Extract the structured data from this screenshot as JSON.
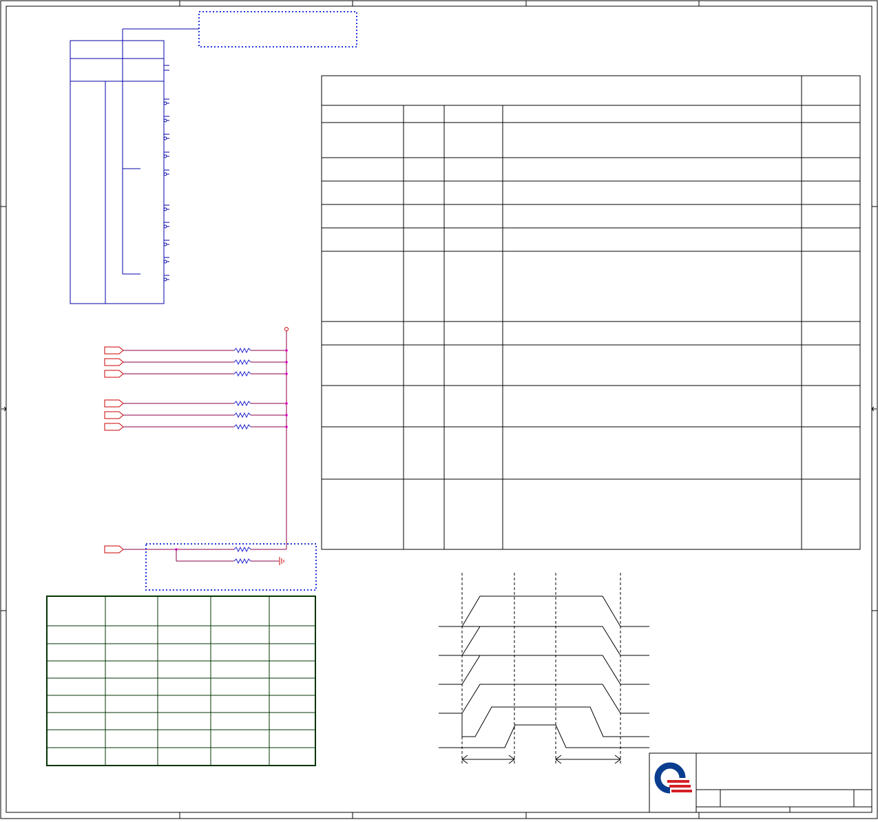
{
  "colors": {
    "frame": "#000000",
    "ic_blue": "#0000aa",
    "dotted_blue": "#2233dd",
    "net_red": "#cc0000",
    "net_purple": "#880044",
    "junction_magenta": "#dd00cc",
    "table_green": "#003300",
    "logo_blue": "#0a3d8f",
    "logo_red": "#d42027"
  },
  "ic_block": {
    "pins_left_side": 12
  },
  "pullup_network": {
    "signal_ports": 6,
    "strap_ports": 1
  },
  "spec_table": {
    "header_columns": 4,
    "body_rows": 11
  },
  "strap_table": {
    "columns": 5,
    "rows": 9
  },
  "timing_diagram": {
    "waveforms": 6,
    "markers": 4
  },
  "title_block": {
    "logo": "quanta-logo"
  }
}
